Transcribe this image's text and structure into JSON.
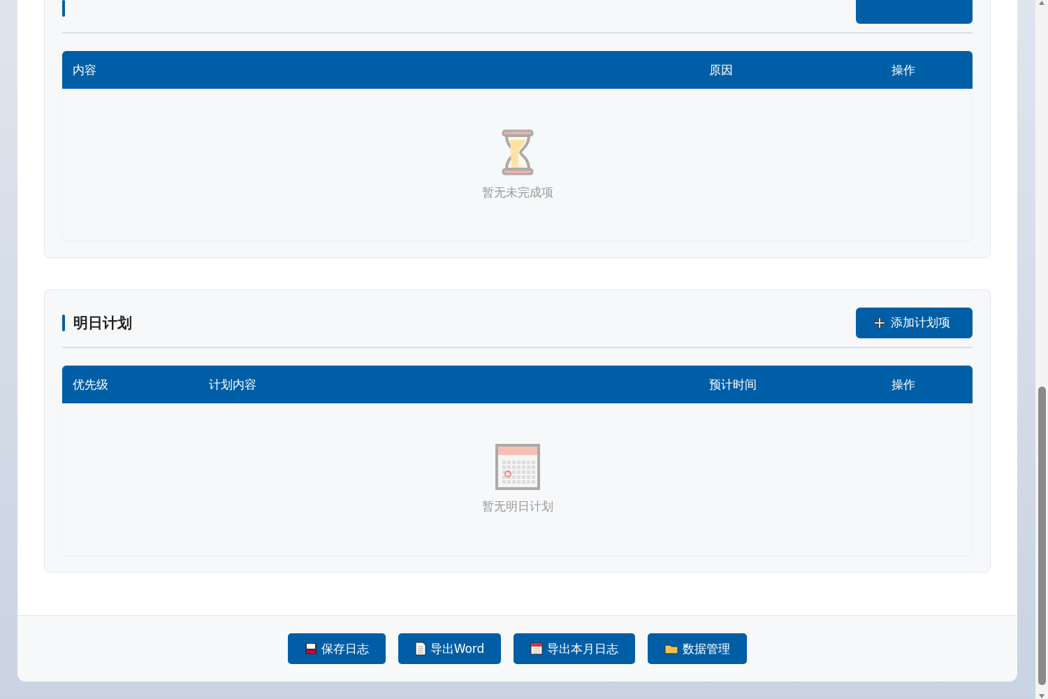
{
  "sections": [
    {
      "columns": [
        {
          "label": "内容"
        },
        {
          "label": "原因"
        },
        {
          "label": "操作"
        }
      ],
      "empty": {
        "kind": "hourglass",
        "text": "暂无未完成项"
      }
    },
    {
      "title": "明日计划",
      "button": "添加计划项",
      "columns": [
        {
          "label": "优先级"
        },
        {
          "label": "计划内容"
        },
        {
          "label": "预计时间"
        },
        {
          "label": "操作"
        }
      ],
      "empty": {
        "kind": "calendar",
        "text": "暂无明日计划"
      }
    }
  ],
  "footer_buttons": [
    {
      "kind": "save",
      "label": "保存日志"
    },
    {
      "kind": "doc",
      "label": "导出Word"
    },
    {
      "kind": "calendar",
      "label": "导出本月日志"
    },
    {
      "kind": "folder",
      "label": "数据管理"
    }
  ]
}
